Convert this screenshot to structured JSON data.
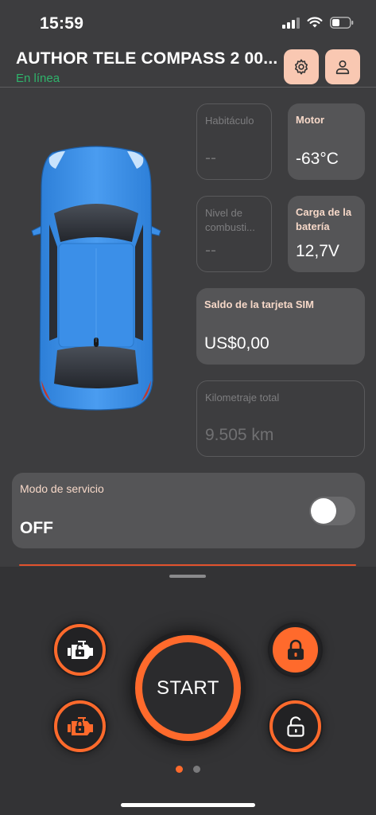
{
  "status_bar": {
    "time": "15:59"
  },
  "header": {
    "title": "AUTHOR TELE COMPASS 2 00...",
    "status": "En línea",
    "settings_icon": "gear-icon",
    "profile_icon": "user-icon"
  },
  "tiles": {
    "cabin": {
      "label": "Habitáculo",
      "value": "--"
    },
    "engine": {
      "label": "Motor",
      "value": "-63°C"
    },
    "fuel": {
      "label": "Nivel de combusti...",
      "value": "--"
    },
    "battery": {
      "label": "Carga de la batería",
      "value": "12,7V"
    },
    "sim": {
      "label": "Saldo de la tarjeta SIM",
      "value": "US$0,00"
    },
    "mileage": {
      "label": "Kilometraje total",
      "value": "9.505 km"
    }
  },
  "service_mode": {
    "label": "Modo de servicio",
    "value": "OFF",
    "enabled": false
  },
  "controls": {
    "start_label": "START",
    "engine_unlock_icon": "engine-unlock-icon",
    "engine_lock_icon": "engine-lock-icon",
    "lock_icon": "lock-icon",
    "unlock_icon": "unlock-icon"
  },
  "pager": {
    "pages": 2,
    "current": 1
  },
  "colors": {
    "accent": "#ff6a2c",
    "online": "#2fb36b",
    "header_button": "#f9c8b2",
    "car_body": "#3b8fe8",
    "background": "#3d3d3f"
  }
}
